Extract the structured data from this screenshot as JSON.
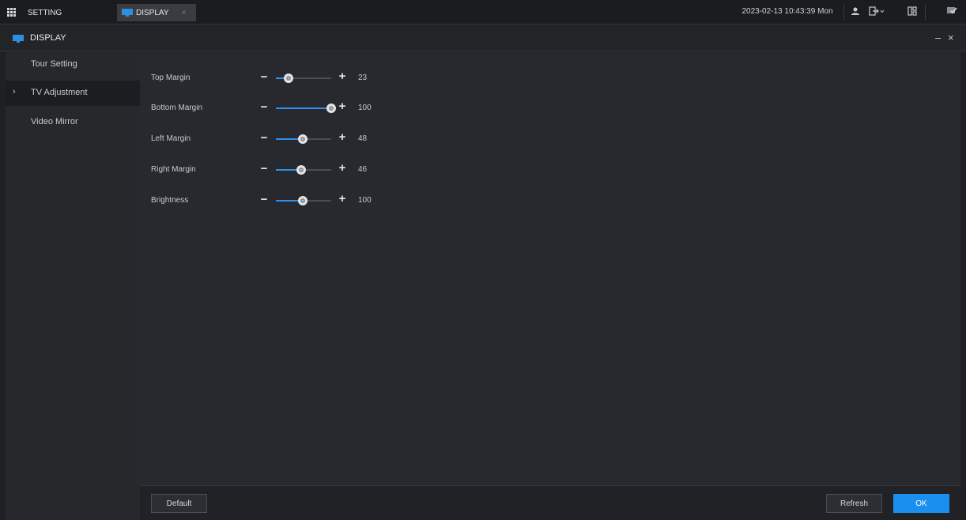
{
  "topbar": {
    "setting_tab": "SETTING",
    "display_tab": "DISPLAY",
    "close_glyph": "×",
    "datetime": "2023-02-13 10:43:39 Mon",
    "icons": [
      "user-icon",
      "logout-icon",
      "layout-icon",
      "monitor-check-icon"
    ]
  },
  "title": {
    "text": "DISPLAY",
    "minimize": "–",
    "close": "×"
  },
  "sidebar": {
    "items": [
      {
        "label": "Tour Setting",
        "active": false
      },
      {
        "label": "TV Adjustment",
        "active": true
      },
      {
        "label": "Video Mirror",
        "active": false
      }
    ],
    "arrow": "›"
  },
  "settings": [
    {
      "label": "Top Margin",
      "value": "23"
    },
    {
      "label": "Bottom Margin",
      "value": "100"
    },
    {
      "label": "Left Margin",
      "value": "48"
    },
    {
      "label": "Right Margin",
      "value": "46"
    },
    {
      "label": "Brightness",
      "value": "100"
    }
  ],
  "slider_levels": [
    0.23,
    1.0,
    0.48,
    0.46,
    0.48
  ],
  "controls": {
    "minus": "−",
    "plus": "+"
  },
  "buttons": {
    "default": "Default",
    "refresh": "Refresh",
    "ok": "OK"
  },
  "colors": {
    "accent": "#1a8ff0",
    "background": "#27292e",
    "sidebar": "#26282c"
  }
}
